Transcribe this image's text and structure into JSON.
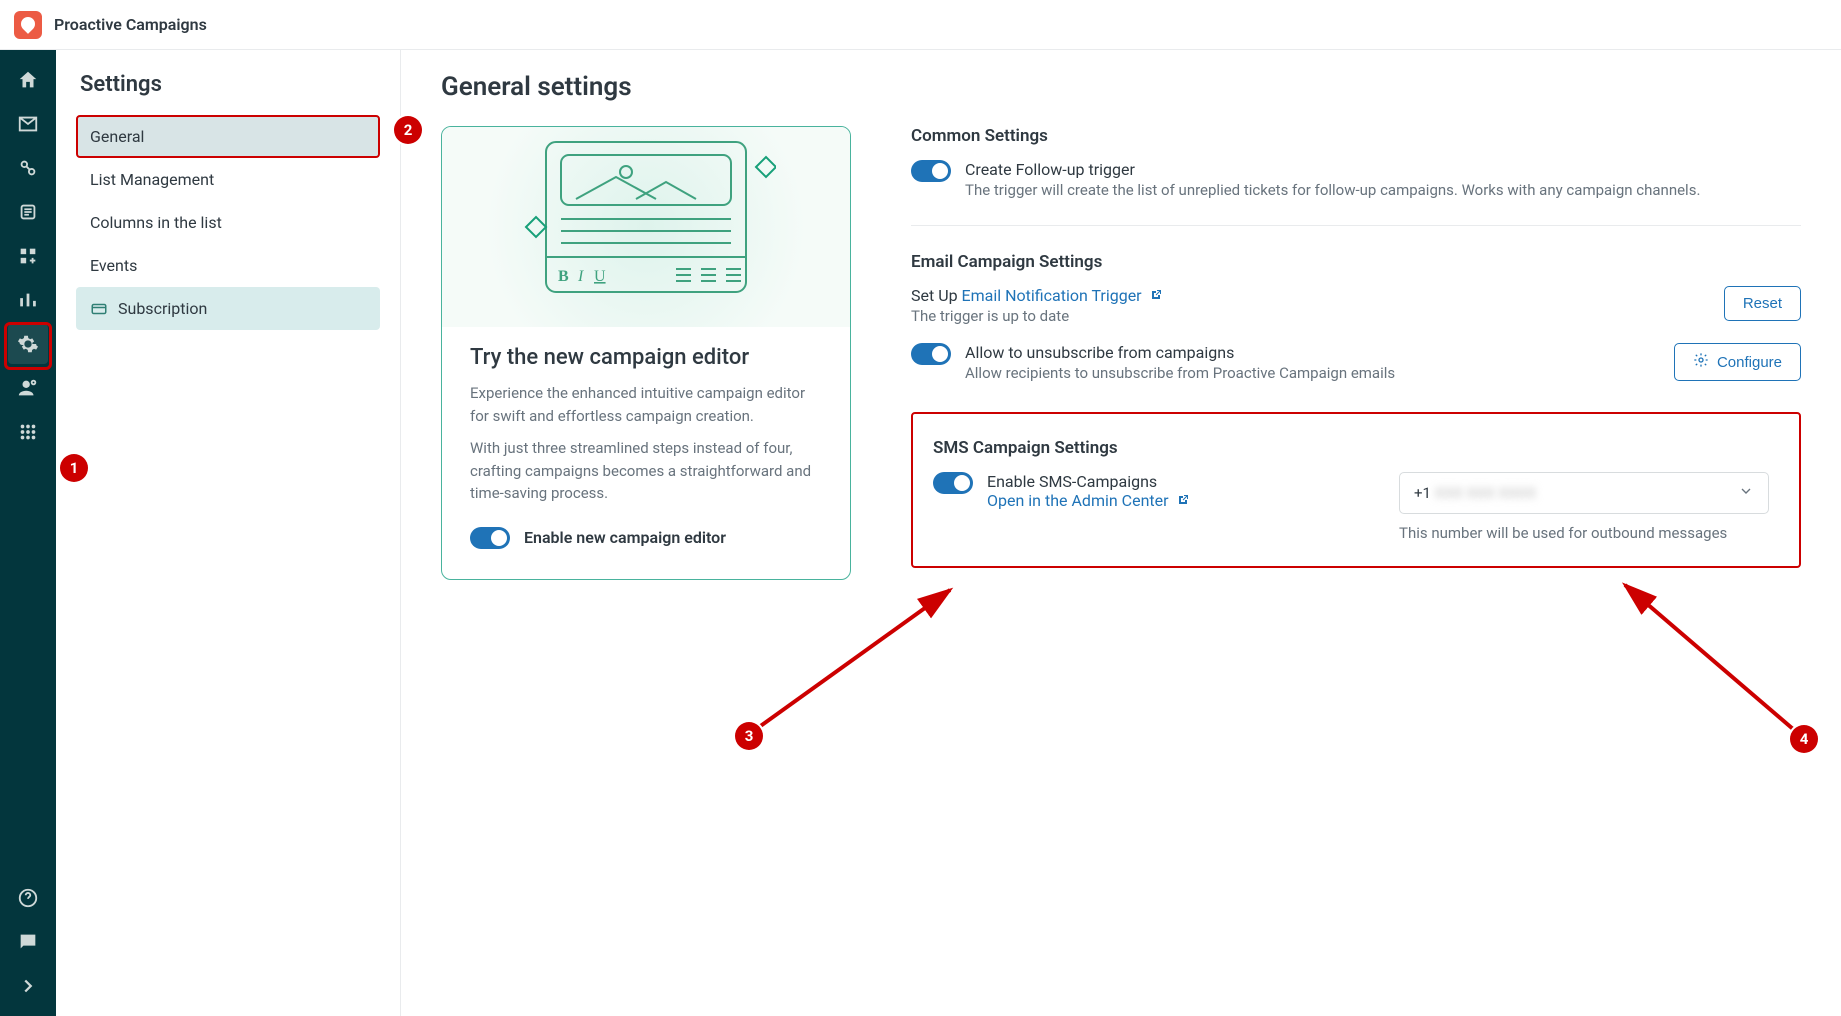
{
  "app_title": "Proactive Campaigns",
  "sidebar": {
    "title": "Settings",
    "items": [
      {
        "label": "General"
      },
      {
        "label": "List Management"
      },
      {
        "label": "Columns in the list"
      },
      {
        "label": "Events"
      },
      {
        "label": "Subscription"
      }
    ]
  },
  "page": {
    "title": "General settings",
    "promo": {
      "heading": "Try the new campaign editor",
      "p1": "Experience the enhanced intuitive campaign editor for swift and effortless campaign creation.",
      "p2": "With just three streamlined steps instead of four, crafting campaigns becomes a straightforward and time-saving process.",
      "toggle_label": "Enable new campaign editor"
    },
    "common": {
      "heading": "Common Settings",
      "followup_label": "Create Follow-up trigger",
      "followup_desc": "The trigger will create the list of unreplied tickets for follow-up campaigns. Works with any campaign channels."
    },
    "email": {
      "heading": "Email Campaign Settings",
      "setup_prefix": "Set Up ",
      "setup_link": "Email Notification Trigger",
      "setup_status": "The trigger is up to date",
      "reset_btn": "Reset",
      "unsub_label": "Allow to unsubscribe from campaigns",
      "unsub_desc": "Allow recipients to unsubscribe from Proactive Campaign emails",
      "configure_btn": "Configure"
    },
    "sms": {
      "heading": "SMS Campaign Settings",
      "enable_label": "Enable SMS-Campaigns",
      "admin_link": "Open in the Admin Center",
      "phone_display": "+1 XXX XXX XXXX",
      "phone_hint": "This number will be used for outbound messages"
    }
  },
  "annotations": {
    "b1": "1",
    "b2": "2",
    "b3": "3",
    "b4": "4"
  }
}
